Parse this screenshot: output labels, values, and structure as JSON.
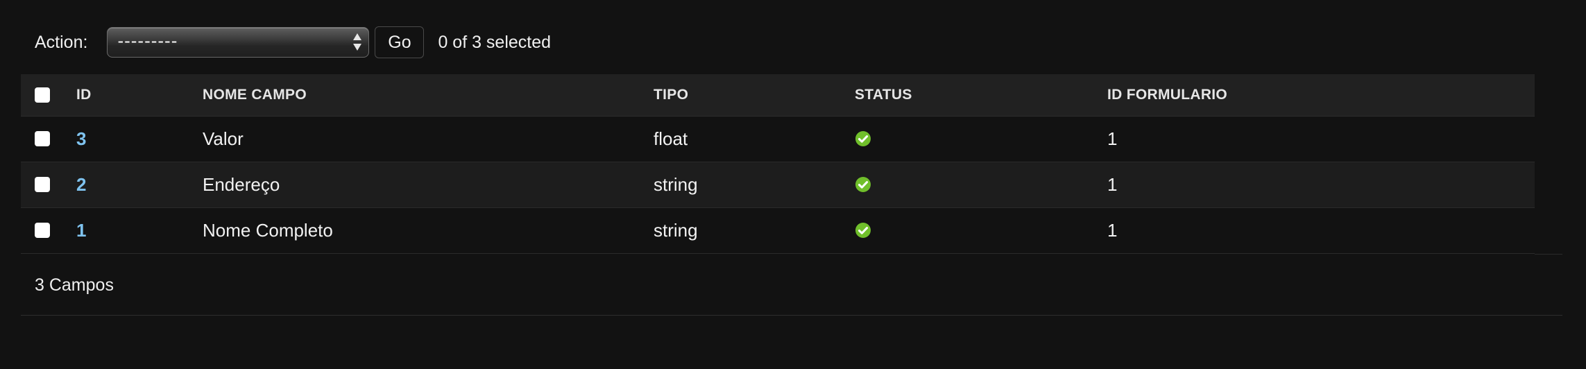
{
  "actions": {
    "label": "Action:",
    "select_value": "---------",
    "go_label": "Go",
    "counter": "0 of 3 selected"
  },
  "table": {
    "headers": {
      "id": "ID",
      "nome_campo": "NOME CAMPO",
      "tipo": "TIPO",
      "status": "STATUS",
      "id_formulario": "ID FORMULARIO"
    },
    "rows": [
      {
        "id": "3",
        "nome_campo": "Valor",
        "tipo": "float",
        "status": "true",
        "id_formulario": "1"
      },
      {
        "id": "2",
        "nome_campo": "Endereço",
        "tipo": "string",
        "status": "true",
        "id_formulario": "1"
      },
      {
        "id": "1",
        "nome_campo": "Nome Completo",
        "tipo": "string",
        "status": "true",
        "id_formulario": "1"
      }
    ]
  },
  "paginator": {
    "text": "3 Campos"
  },
  "colors": {
    "link": "#7fc3ef",
    "status_ok": "#70bf2b",
    "background": "#121212"
  },
  "icons": {
    "status": "checkmark-circle-icon",
    "select": "up-down-arrows-icon"
  }
}
